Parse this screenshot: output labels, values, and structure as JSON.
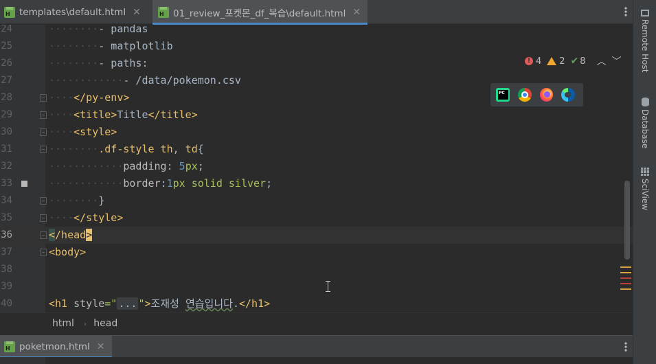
{
  "tabs": [
    {
      "label": "templates\\default.html",
      "active": false
    },
    {
      "label": "01_review_포켓몬_df_복습\\default.html",
      "active": true
    }
  ],
  "editor": {
    "lines": [
      {
        "num": "24",
        "indent": "········",
        "html": "- pandas"
      },
      {
        "num": "25",
        "indent": "········",
        "html": "- matplotlib"
      },
      {
        "num": "26",
        "indent": "········",
        "html": "- paths:"
      },
      {
        "num": "27",
        "indent": "············",
        "html": "- /data/pokemon.csv"
      },
      {
        "num": "28",
        "indent": "····",
        "html": "&lt;/py-env&gt;"
      },
      {
        "num": "29",
        "indent": "····",
        "html": "&lt;title&gt;Title&lt;/title&gt;"
      },
      {
        "num": "30",
        "indent": "····",
        "html": "&lt;style&gt;"
      },
      {
        "num": "31",
        "indent": "········",
        "html": ".df-style th, td{"
      },
      {
        "num": "32",
        "indent": "············",
        "html": "padding: 5px;"
      },
      {
        "num": "33",
        "indent": "············",
        "html": "border:1px solid silver;"
      },
      {
        "num": "34",
        "indent": "········",
        "html": "}"
      },
      {
        "num": "35",
        "indent": "····",
        "html": "&lt;/style&gt;"
      },
      {
        "num": "36",
        "indent": "",
        "html": "&lt;/head&gt;"
      },
      {
        "num": "37",
        "indent": "",
        "html": "&lt;body&gt;"
      },
      {
        "num": "38",
        "indent": "",
        "html": ""
      },
      {
        "num": "39",
        "indent": "",
        "html": ""
      },
      {
        "num": "40",
        "indent": "",
        "html": "&lt;h1 style=\"...\"&gt;조재성 연습입니다.&lt;/h1&gt;"
      }
    ]
  },
  "inspections": {
    "errors": "4",
    "warnings": "2",
    "ok": "8"
  },
  "browsers": [
    "pycharm-icon",
    "chrome-icon",
    "firefox-icon",
    "edge-icon"
  ],
  "breadcrumb": [
    "html",
    "head"
  ],
  "bottom_tab": {
    "label": "poketmon.html"
  },
  "right_tools": [
    "Remote Host",
    "Database",
    "SciView"
  ],
  "colors": {
    "tag": "#e8bf6a",
    "string": "#a5c25c",
    "number": "#6897bb",
    "accent": "#4a88c7"
  }
}
